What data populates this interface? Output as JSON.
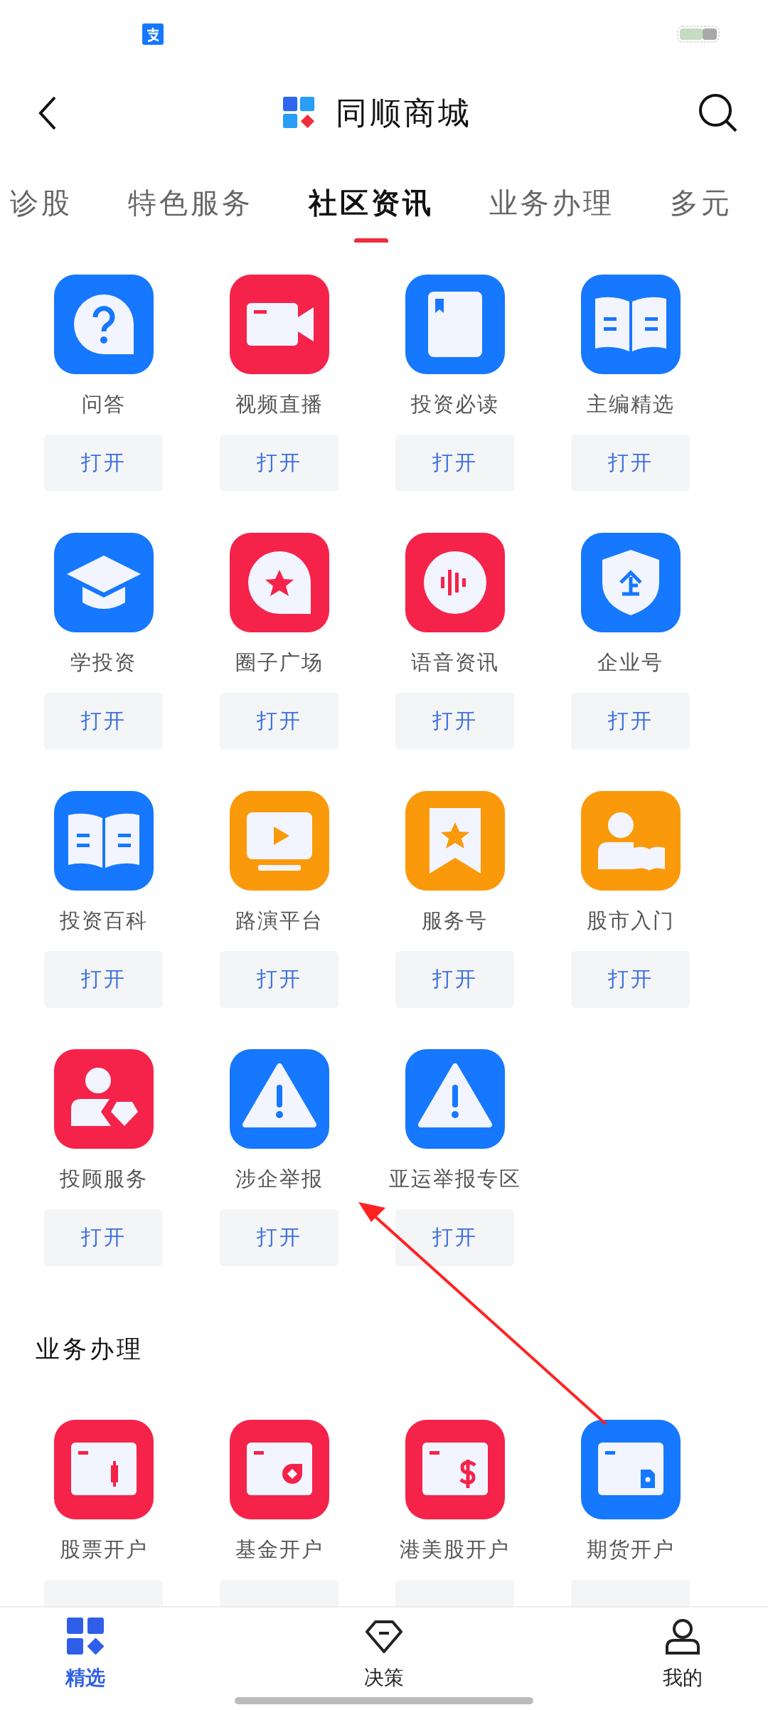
{
  "header": {
    "title": "同顺商城"
  },
  "tabs": [
    {
      "label": "诊股",
      "selected": false
    },
    {
      "label": "特色服务",
      "selected": false
    },
    {
      "label": "社区资讯",
      "selected": true
    },
    {
      "label": "业务办理",
      "selected": false
    },
    {
      "label": "多元",
      "selected": false
    }
  ],
  "sections": [
    {
      "items": [
        {
          "label": "问答",
          "color": "#1677ff",
          "button": "打开"
        },
        {
          "label": "视频直播",
          "color": "#f5234a",
          "button": "打开"
        },
        {
          "label": "投资必读",
          "color": "#1677ff",
          "button": "打开"
        },
        {
          "label": "主编精选",
          "color": "#1677ff",
          "button": "打开"
        },
        {
          "label": "学投资",
          "color": "#1677ff",
          "button": "打开"
        },
        {
          "label": "圈子广场",
          "color": "#f5234a",
          "button": "打开"
        },
        {
          "label": "语音资讯",
          "color": "#f5234a",
          "button": "打开"
        },
        {
          "label": "企业号",
          "color": "#1677ff",
          "button": "打开"
        },
        {
          "label": "投资百科",
          "color": "#1677ff",
          "button": "打开"
        },
        {
          "label": "路演平台",
          "color": "#fa9a0a",
          "button": "打开"
        },
        {
          "label": "服务号",
          "color": "#fa9a0a",
          "button": "打开"
        },
        {
          "label": "股市入门",
          "color": "#fa9a0a",
          "button": "打开"
        },
        {
          "label": "投顾服务",
          "color": "#f5234a",
          "button": "打开"
        },
        {
          "label": "涉企举报",
          "color": "#1677ff",
          "button": "打开"
        },
        {
          "label": "亚运举报专区",
          "color": "#1677ff",
          "button": "打开"
        }
      ]
    },
    {
      "title": "业务办理",
      "items": [
        {
          "label": "股票开户",
          "color": "#f5234a"
        },
        {
          "label": "基金开户",
          "color": "#f5234a"
        },
        {
          "label": "港美股开户",
          "color": "#f5234a"
        },
        {
          "label": "期货开户",
          "color": "#1677ff"
        }
      ]
    }
  ],
  "bottom_nav": [
    {
      "label": "精选",
      "selected": true
    },
    {
      "label": "决策",
      "selected": false
    },
    {
      "label": "我的",
      "selected": false
    }
  ]
}
